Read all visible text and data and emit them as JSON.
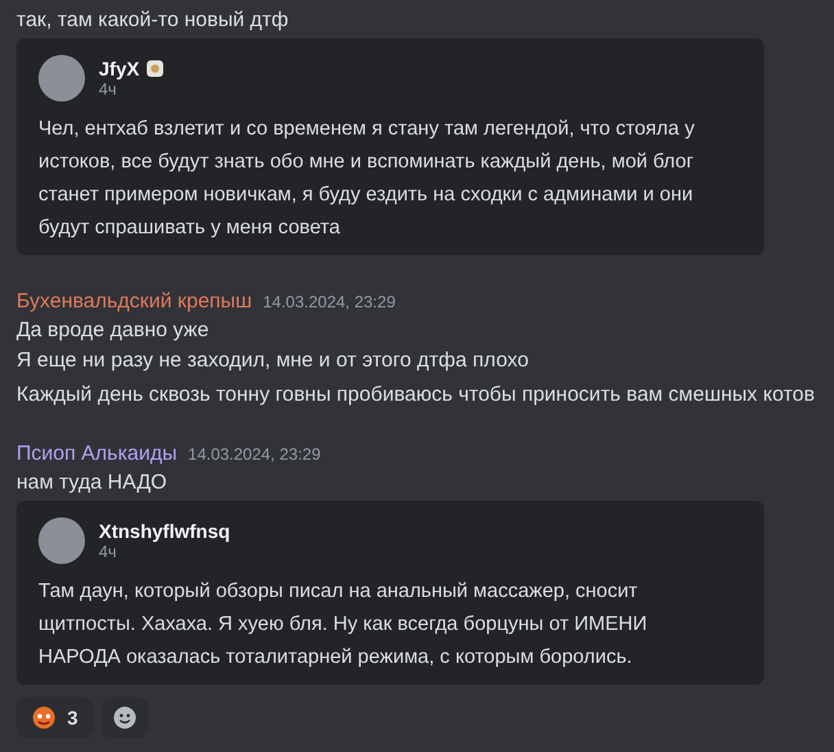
{
  "messages": [
    {
      "kind": "continuation",
      "lines": [
        "так, там какой-то новый дтф"
      ],
      "embed": {
        "author": "JfyX",
        "badge": true,
        "time": "4ч",
        "text": "Чел, ентхаб взлетит и со временем я стану там легендой, что стояла у истоков, все будут знать обо мне и вспоминать каждый день, мой блог станет примером новичкам, я буду ездить на сходки с админами и они будут спрашивать у меня совета"
      }
    },
    {
      "kind": "full",
      "author": "Бухенвальдский крепыш",
      "color": "#e0795a",
      "time": "14.03.2024, 23:29",
      "lines": [
        "Да вроде давно уже",
        "Я еще ни разу не заходил, мне и от этого дтфа плохо",
        "Каждый день сквозь тонну говны пробиваюсь чтобы приносить вам смешных котов"
      ]
    },
    {
      "kind": "full",
      "author": "Псиоп Алькаиды",
      "color": "#b4a0f0",
      "time": "14.03.2024, 23:29",
      "lines": [
        "нам туда НАДО"
      ],
      "embed": {
        "author": "Xtnshyflwfnsq",
        "badge": false,
        "time": "4ч",
        "text": "Там даун, который обзоры писал на анальный массажер, сносит щитпосты. Хахаха. Я хуею бля. Ну как всегда борцуны от ИМЕНИ НАРОДА оказалась тоталитарней режима, с которым боролись."
      },
      "reactions": [
        {
          "count": "3",
          "selected": false
        }
      ]
    }
  ]
}
